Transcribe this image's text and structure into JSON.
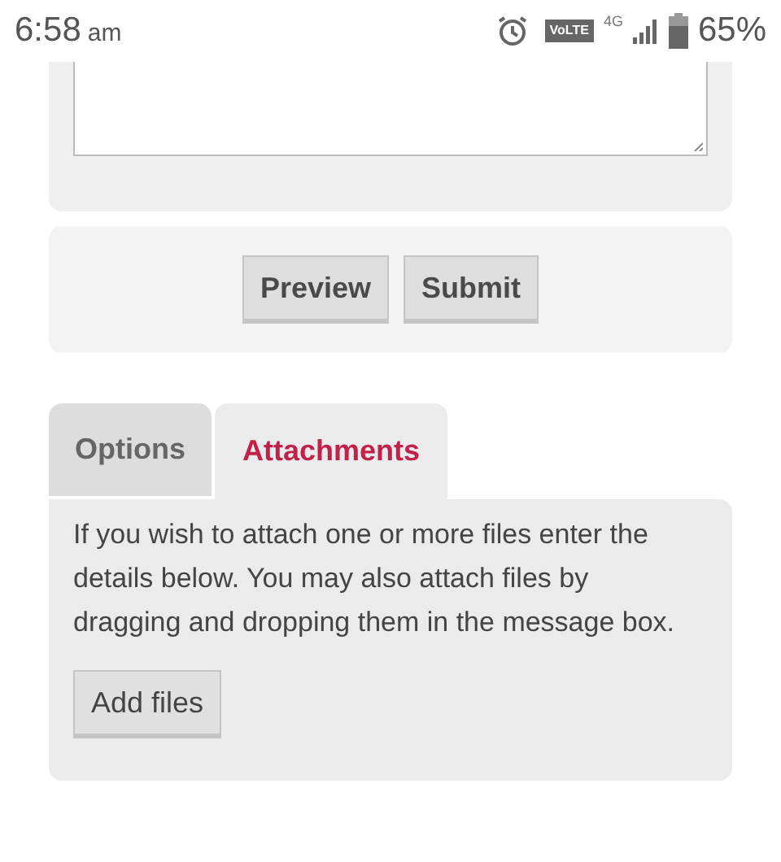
{
  "status_bar": {
    "time": "6:58",
    "ampm": "am",
    "volte": "VoLTE",
    "network": "4G",
    "battery": "65%"
  },
  "buttons": [
    "Preview",
    "Submit"
  ],
  "tabs": [
    {
      "label": "Options",
      "selected": false
    },
    {
      "label": "Attachments",
      "selected": true
    }
  ],
  "attachments": {
    "text": "If you wish to attach one or more files enter the details below. You may also attach files by dragging and dropping them in the message box.",
    "button": "Add files"
  }
}
